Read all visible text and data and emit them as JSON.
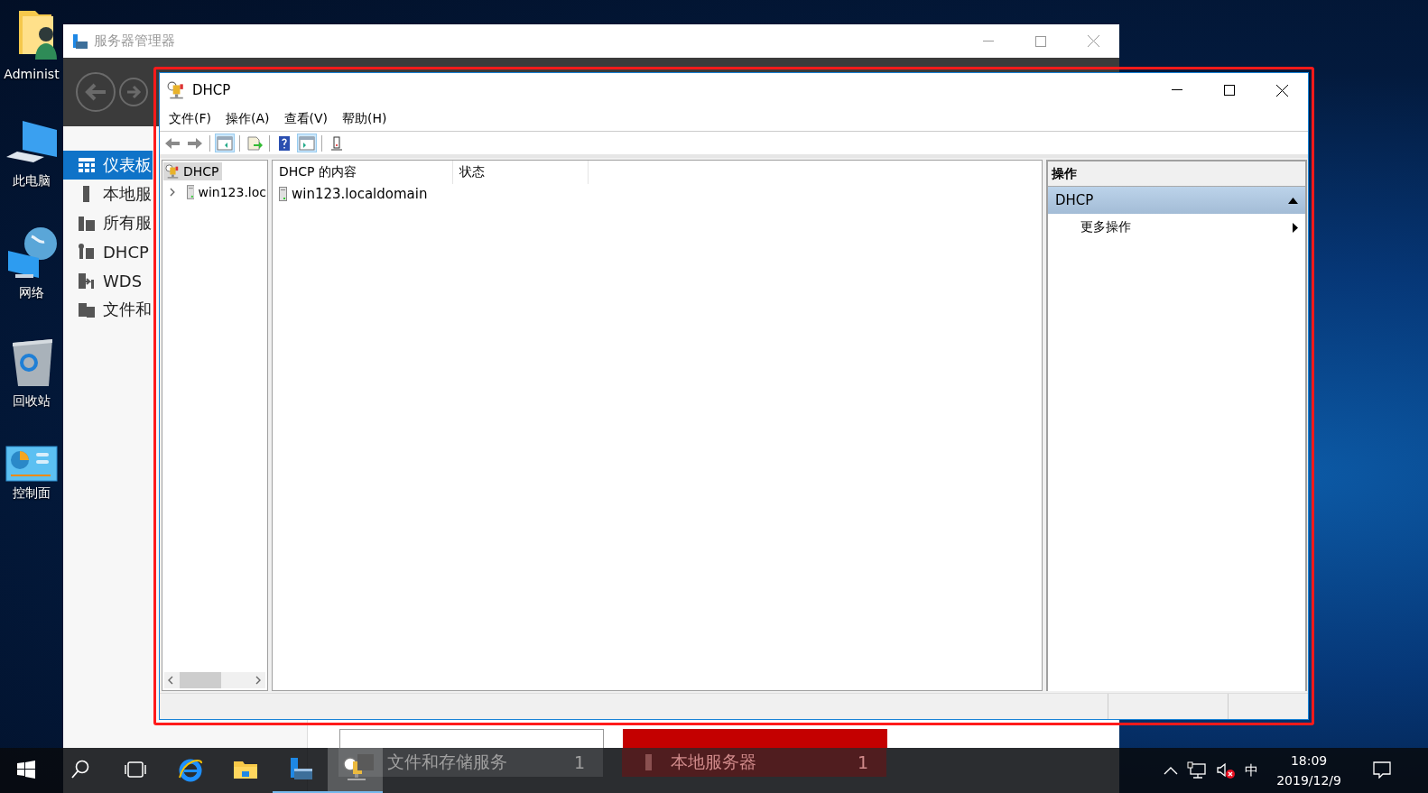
{
  "desktop_icons": [
    {
      "kind": "user-folder",
      "label": "Administ"
    },
    {
      "kind": "computer",
      "label": "此电脑"
    },
    {
      "kind": "network",
      "label": "网络"
    },
    {
      "kind": "recycle-bin",
      "label": "回收站"
    },
    {
      "kind": "control-panel",
      "label": "控制面"
    }
  ],
  "server_manager": {
    "title": "服务器管理器",
    "nav": [
      {
        "kind": "dashboard",
        "label": "仪表板",
        "selected": true
      },
      {
        "kind": "server",
        "label": "本地服",
        "selected": false
      },
      {
        "kind": "servers",
        "label": "所有服",
        "selected": false
      },
      {
        "kind": "dhcp",
        "label": "DHCP",
        "selected": false
      },
      {
        "kind": "wds",
        "label": "WDS",
        "selected": false
      },
      {
        "kind": "files",
        "label": "文件和",
        "selected": false
      }
    ],
    "tiles": [
      {
        "kind": "normal",
        "title": "文件和存储服务",
        "count": "1"
      },
      {
        "kind": "alert",
        "title": "本地服务器",
        "count": "1"
      }
    ]
  },
  "dhcp_window": {
    "title": "DHCP",
    "menu": [
      "文件(F)",
      "操作(A)",
      "查看(V)",
      "帮助(H)"
    ],
    "toolbar": [
      {
        "kind": "back",
        "pressed": false
      },
      {
        "kind": "forward",
        "pressed": false
      },
      {
        "kind": "separator"
      },
      {
        "kind": "console-tree",
        "pressed": true
      },
      {
        "kind": "separator"
      },
      {
        "kind": "export",
        "pressed": false
      },
      {
        "kind": "separator"
      },
      {
        "kind": "help",
        "pressed": false
      },
      {
        "kind": "action-pane",
        "pressed": true
      },
      {
        "kind": "separator"
      },
      {
        "kind": "server",
        "pressed": false
      }
    ],
    "tree": [
      {
        "label": "DHCP",
        "selected": true,
        "children": [
          {
            "label": "win123.loc",
            "expanded": false,
            "selected": false
          }
        ]
      }
    ],
    "columns": [
      "DHCP 的内容",
      "状态"
    ],
    "rows": [
      {
        "name": "win123.localdomain"
      }
    ],
    "actions": {
      "header": "操作",
      "sections": [
        {
          "title": "DHCP",
          "expanded": true,
          "items": [
            {
              "label": "更多操作",
              "submenu": true
            }
          ]
        }
      ]
    }
  },
  "taskbar": {
    "apps": [
      {
        "kind": "ie",
        "running": false,
        "selected": false
      },
      {
        "kind": "explorer",
        "running": false,
        "selected": false
      },
      {
        "kind": "server-manager",
        "running": true,
        "selected": false
      },
      {
        "kind": "dhcp",
        "running": true,
        "selected": true
      }
    ],
    "ime": "中",
    "time": "18:09",
    "date": "2019/12/9"
  }
}
